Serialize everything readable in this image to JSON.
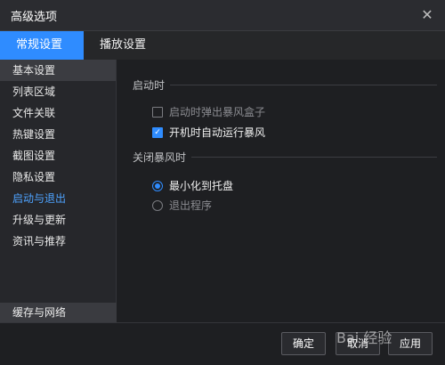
{
  "window": {
    "title": "高级选项"
  },
  "tabs": [
    {
      "label": "常规设置",
      "active": true
    },
    {
      "label": "播放设置",
      "active": false
    }
  ],
  "sidebar": {
    "items": [
      {
        "label": "基本设置"
      },
      {
        "label": "列表区域"
      },
      {
        "label": "文件关联"
      },
      {
        "label": "热键设置"
      },
      {
        "label": "截图设置"
      },
      {
        "label": "隐私设置"
      },
      {
        "label": "启动与退出"
      },
      {
        "label": "升级与更新"
      },
      {
        "label": "资讯与推荐"
      }
    ],
    "bottom_item": {
      "label": "缓存与网络"
    }
  },
  "content": {
    "startup": {
      "heading": "启动时",
      "options": [
        {
          "label": "启动时弹出暴风盒子",
          "checked": false,
          "disabled": true
        },
        {
          "label": "开机时自动运行暴风",
          "checked": true,
          "disabled": false
        }
      ]
    },
    "close": {
      "heading": "关闭暴风时",
      "options": [
        {
          "label": "最小化到托盘",
          "selected": true
        },
        {
          "label": "退出程序",
          "selected": false
        }
      ]
    }
  },
  "footer": {
    "ok_label": "确定",
    "cancel_label": "取消",
    "apply_label": "应用"
  },
  "watermark": "Bai 经验",
  "colors": {
    "accent": "#2f8cff",
    "active_text": "#4ea3ff"
  }
}
